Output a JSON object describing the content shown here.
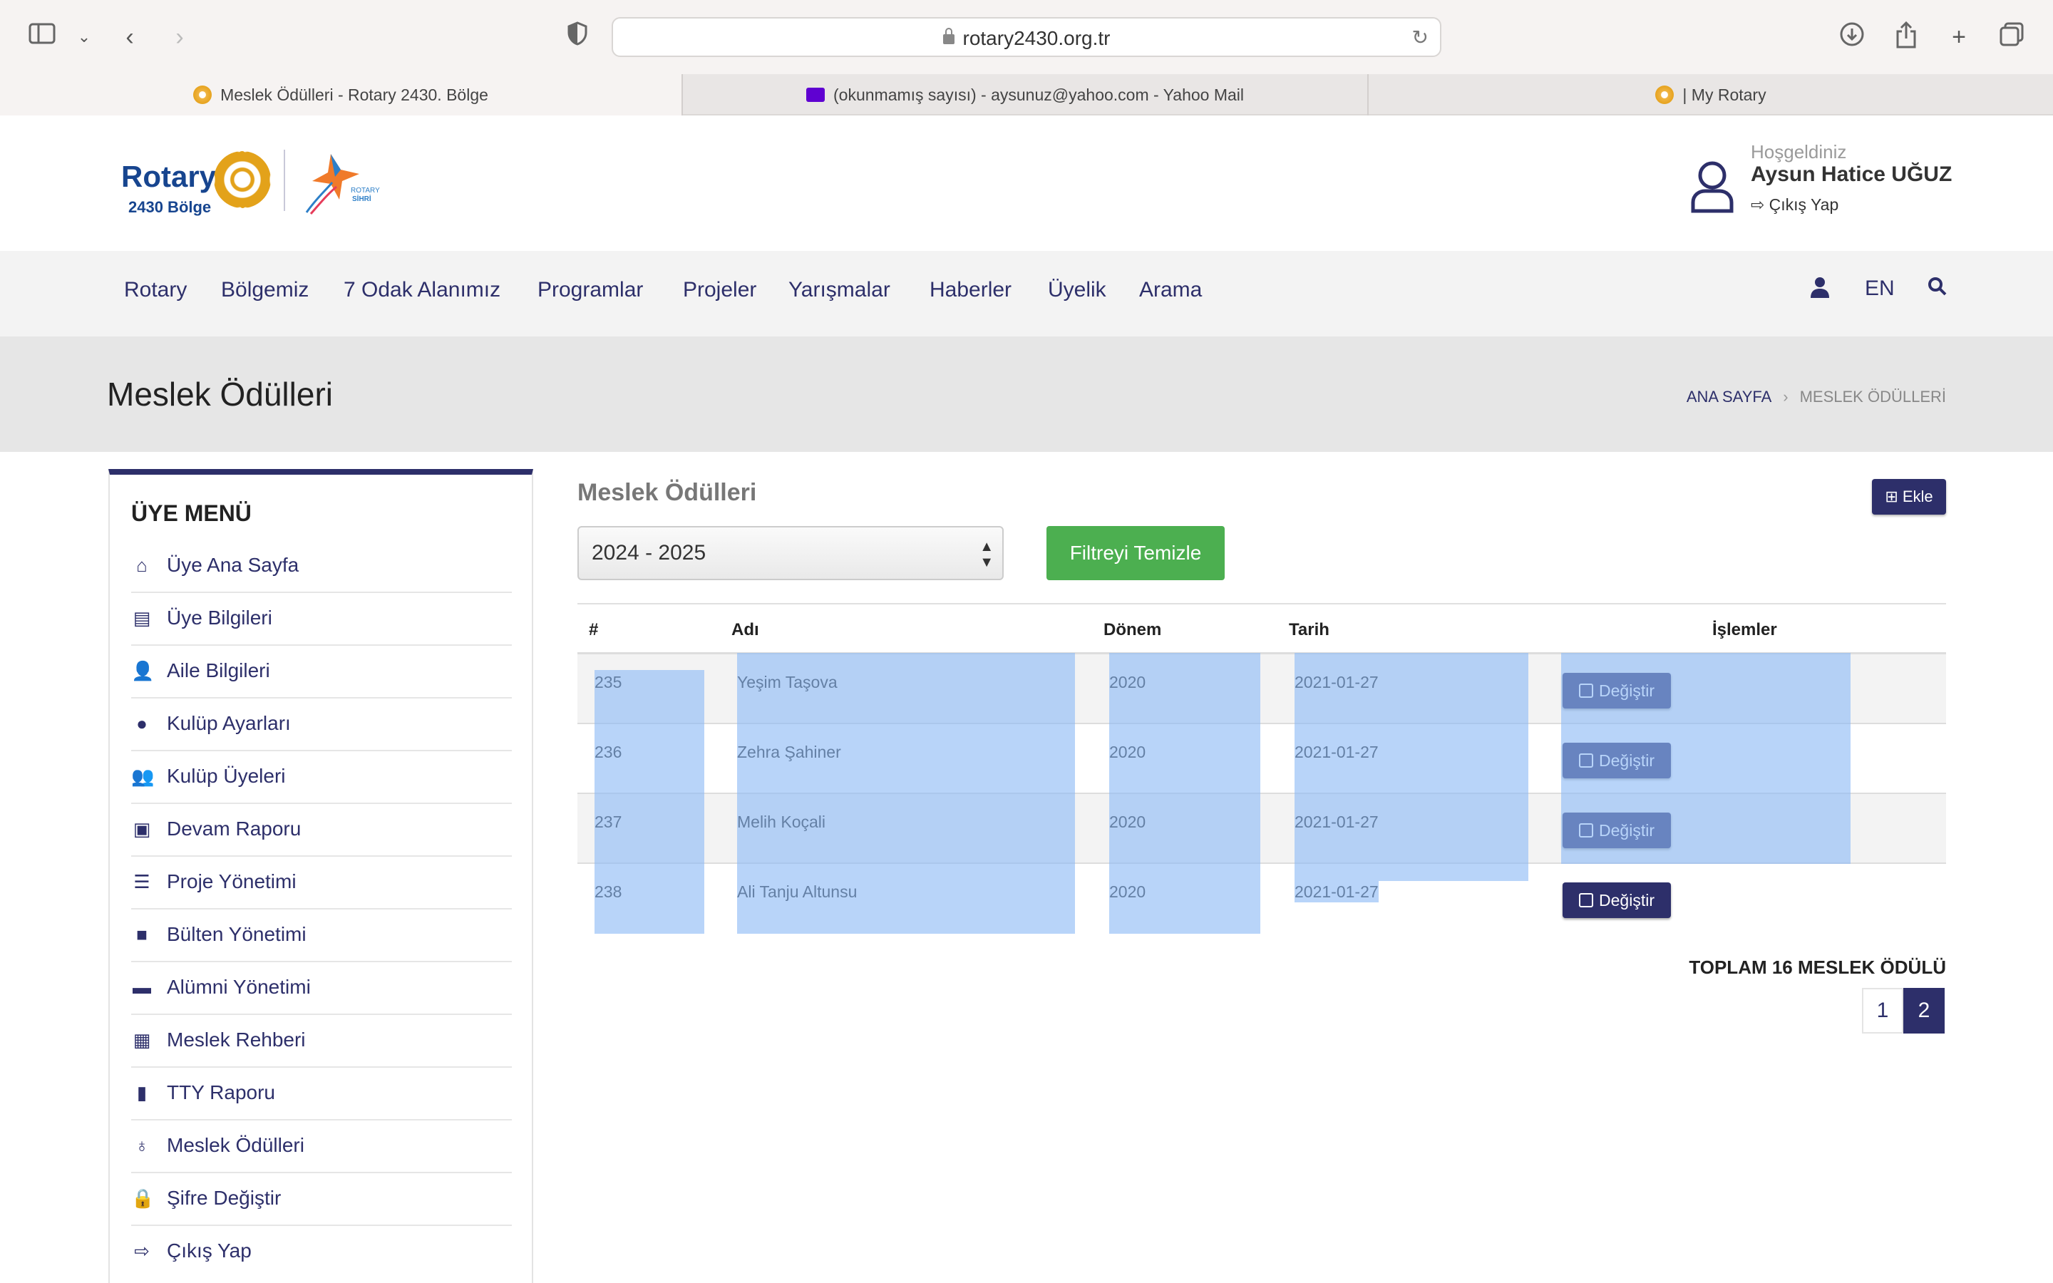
{
  "browser": {
    "url": "rotary2430.org.tr",
    "tabs": [
      {
        "label": "Meslek Ödülleri - Rotary 2430. Bölge",
        "icon": "rotary-wheel-icon"
      },
      {
        "label": "(okunmamış sayısı) - aysunuz@yahoo.com - Yahoo Mail",
        "icon": "mail-icon"
      },
      {
        "label": "| My Rotary",
        "icon": "rotary-wheel-icon"
      }
    ]
  },
  "header": {
    "logo_text": "Rotary",
    "logo_sub": "2430 Bölge",
    "secondary_logo": "ROTARY SİHRİ",
    "greeting": "Hoşgeldiniz",
    "user_name": "Aysun Hatice UĞUZ",
    "logout": "Çıkış Yap"
  },
  "nav": {
    "items": [
      "Rotary",
      "Bölgemiz",
      "7 Odak Alanımız",
      "Programlar",
      "Projeler",
      "Yarışmalar",
      "Haberler",
      "Üyelik",
      "Arama"
    ],
    "lang": "EN"
  },
  "page": {
    "title": "Meslek Ödülleri",
    "breadcrumb_home": "ANA SAYFA",
    "breadcrumb_current": "MESLEK ÖDÜLLERİ"
  },
  "sidebar": {
    "title": "ÜYE MENÜ",
    "items": [
      {
        "label": "Üye Ana Sayfa",
        "icon": "home-icon"
      },
      {
        "label": "Üye Bilgileri",
        "icon": "id-card-icon"
      },
      {
        "label": "Aile Bilgileri",
        "icon": "user-plus-icon"
      },
      {
        "label": "Kulüp Ayarları",
        "icon": "map-marker-icon"
      },
      {
        "label": "Kulüp Üyeleri",
        "icon": "users-icon"
      },
      {
        "label": "Devam Raporu",
        "icon": "book-reader-icon"
      },
      {
        "label": "Proje Yönetimi",
        "icon": "tasks-icon"
      },
      {
        "label": "Bülten Yönetimi",
        "icon": "book-icon"
      },
      {
        "label": "Alümni Yönetimi",
        "icon": "couch-icon"
      },
      {
        "label": "Meslek Rehberi",
        "icon": "address-book-icon"
      },
      {
        "label": "TTY Raporu",
        "icon": "file-icon"
      },
      {
        "label": "Meslek Ödülleri",
        "icon": "award-icon"
      },
      {
        "label": "Şifre Değiştir",
        "icon": "lock-icon"
      },
      {
        "label": "Çıkış Yap",
        "icon": "sign-out-icon"
      }
    ]
  },
  "content": {
    "title": "Meslek Ödülleri",
    "add_label": "Ekle",
    "period_selected": "2024 - 2025",
    "clear_filter": "Filtreyi Temizle",
    "table": {
      "headers": [
        "#",
        "Adı",
        "Dönem",
        "Tarih",
        "İşlemler"
      ],
      "rows": [
        {
          "id": "235",
          "name": "Yeşim Taşova",
          "period": "2020",
          "date": "2021-01-27",
          "action": "Değiştir"
        },
        {
          "id": "236",
          "name": "Zehra Şahiner",
          "period": "2020",
          "date": "2021-01-27",
          "action": "Değiştir"
        },
        {
          "id": "237",
          "name": "Melih Koçali",
          "period": "2020",
          "date": "2021-01-27",
          "action": "Değiştir"
        },
        {
          "id": "238",
          "name": "Ali Tanju Altunsu",
          "period": "2020",
          "date": "2021-01-27",
          "action": "Değiştir"
        }
      ]
    },
    "total_label": "TOPLAM 16 MESLEK ÖDÜLÜ",
    "pages": [
      "1",
      "2"
    ],
    "current_page": "2"
  },
  "colors": {
    "brand_navy": "#2d2f6a",
    "accent_green": "#4caf50",
    "rotary_gold": "#e3a21a",
    "selection_blue": "#8cb9f5"
  }
}
